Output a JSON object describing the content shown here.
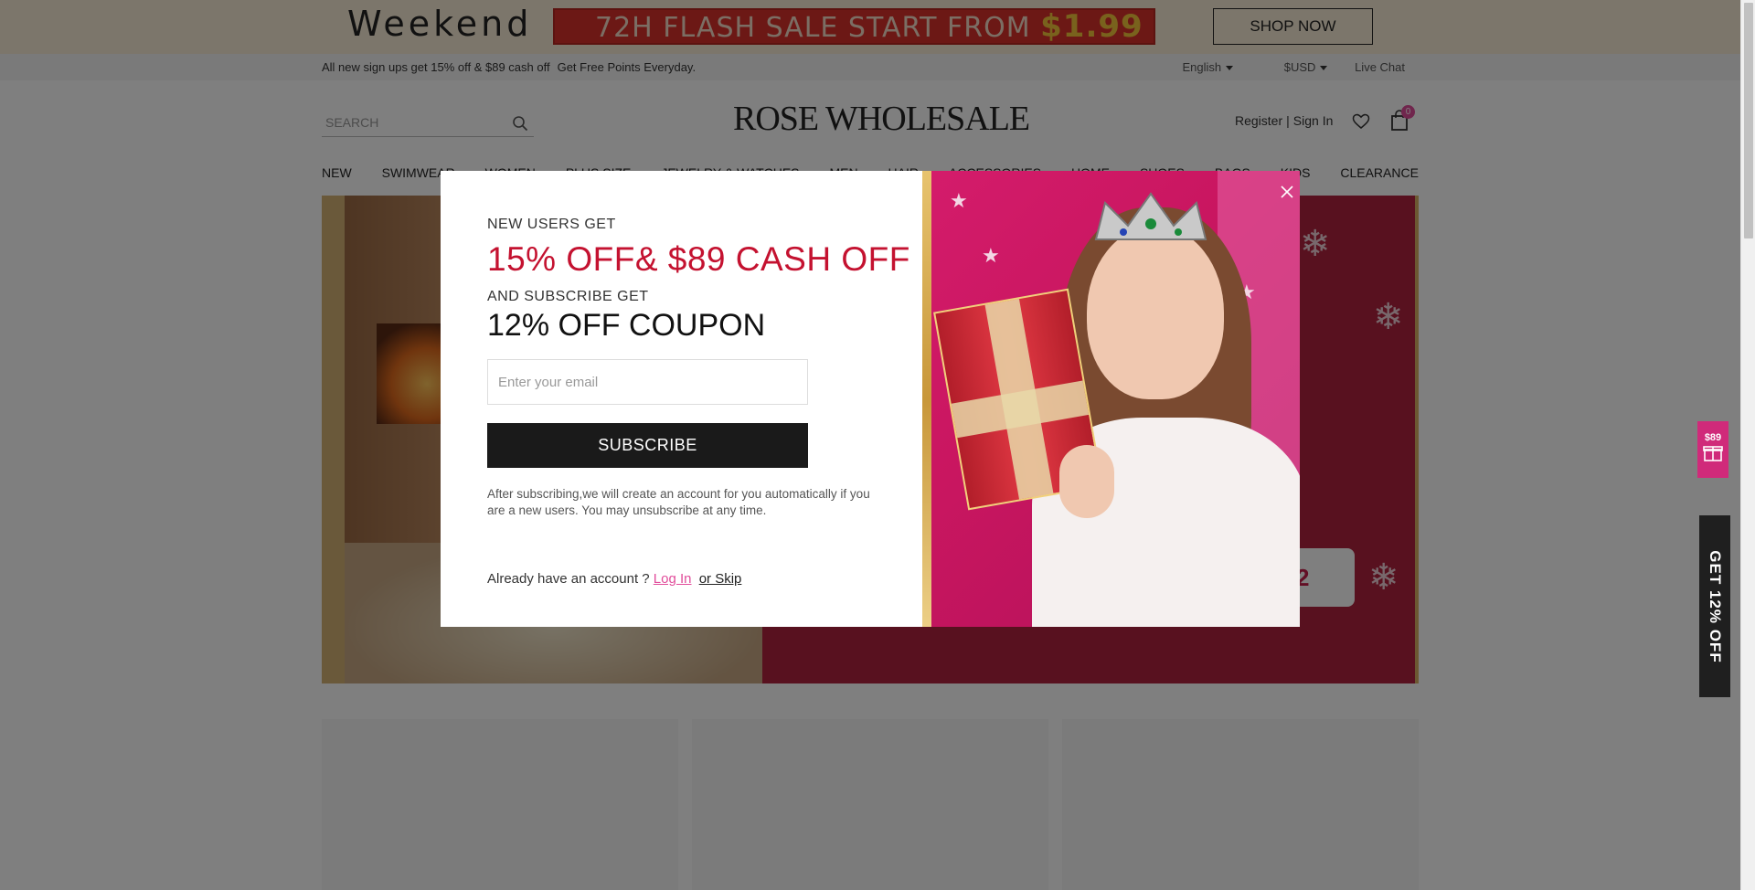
{
  "promo": {
    "weekend": "Weekend",
    "flash_text": "72H FLASH SALE START FROM ",
    "flash_price": "$1.99",
    "shop_now": "SHOP NOW"
  },
  "infobar": {
    "signup_text": "All new sign ups get 15% off & $89 cash off",
    "points_text": "Get Free Points Everyday.",
    "language": "English",
    "currency": "$USD",
    "live_chat": "Live Chat"
  },
  "header": {
    "search_placeholder": "SEARCH",
    "logo": "ROSE WHOLESALE",
    "register": "Register",
    "separator": "|",
    "sign_in": "Sign In",
    "cart_count": "0"
  },
  "nav": {
    "items": [
      "NEW",
      "SWIMWEAR",
      "WOMEN",
      "PLUS SIZE",
      "JEWELRY & WATCHES",
      "MEN",
      "HAIR",
      "ACCESSORIES",
      "HOME",
      "SHOES",
      "BAGS",
      "KIDS",
      "CLEARANCE"
    ]
  },
  "hero": {
    "code_fragment": "MS2"
  },
  "side": {
    "cash_amount": "$89",
    "coupon_tab": "GET 12% OFF"
  },
  "modal": {
    "line1": "NEW USERS GET",
    "line2": "15% OFF& $89 CASH OFF",
    "line3": "AND SUBSCRIBE GET",
    "line4": "12% OFF COUPON",
    "email_placeholder": "Enter your email",
    "subscribe": "SUBSCRIBE",
    "note": "After subscribing,we will create an account for you automatically if you are a new users. You may unsubscribe at any time.",
    "already": "Already have an account ?",
    "login": "Log In",
    "skip": "or Skip"
  },
  "colors": {
    "accent_red": "#c41230",
    "pink": "#e14c9a",
    "dark": "#1a1a1a"
  }
}
